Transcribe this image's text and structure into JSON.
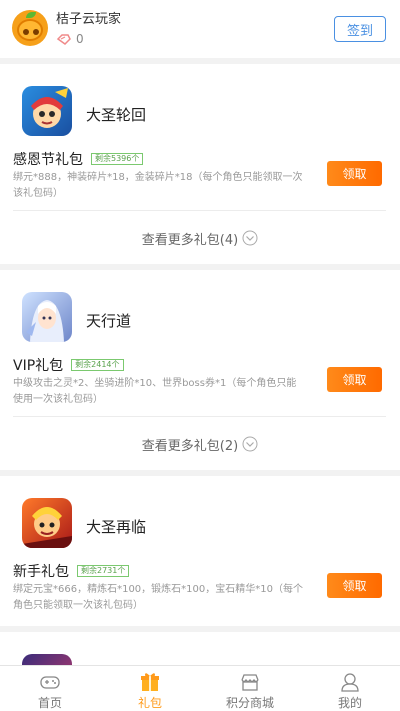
{
  "header": {
    "user_name": "桔子云玩家",
    "points_value": "0",
    "checkin_label": "签到"
  },
  "games": [
    {
      "name": "大圣轮回",
      "gift_title": "感恩节礼包",
      "remain": "剩余5396个",
      "desc": "绑元*888，神装碎片*18，金装碎片*18（每个角色只能领取一次该礼包码）",
      "button": "领取",
      "more": "查看更多礼包(4)"
    },
    {
      "name": "天行道",
      "gift_title": "VIP礼包",
      "remain": "剩余2414个",
      "desc": "中级攻击之灵*2、坐骑进阶*10、世界boss券*1（每个角色只能使用一次该礼包码）",
      "button": "领取",
      "more": "查看更多礼包(2)"
    },
    {
      "name": "大圣再临",
      "gift_title": "新手礼包",
      "remain": "剩余2731个",
      "desc": "绑定元宝*666，精炼石*100，锻炼石*100，宝石精华*10（每个角色只能领取一次该礼包码）",
      "button": "领取"
    }
  ],
  "nav": {
    "home": "首页",
    "gift": "礼包",
    "mall": "积分商城",
    "mine": "我的"
  },
  "colors": {
    "accent": "#ff9a1a",
    "button": "#ff6a00",
    "checkin": "#4a90e2",
    "badge": "#7bc96f"
  }
}
